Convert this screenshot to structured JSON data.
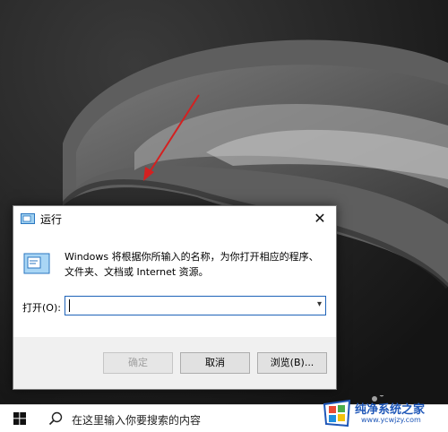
{
  "dialog": {
    "title": "运行",
    "close_label": "✕",
    "description": "Windows 将根据你所输入的名称，为你打开相应的程序、文件夹、文档或 Internet 资源。",
    "open_label": "打开(O):",
    "open_value": "",
    "buttons": {
      "ok": "确定",
      "cancel": "取消",
      "browse": "浏览(B)..."
    }
  },
  "taskbar": {
    "search_placeholder": "在这里输入你要搜索的内容"
  },
  "watermark": {
    "title": "纯净系统之家",
    "url": "www.ycwjzy.com"
  },
  "icons": {
    "start": "windows-logo-icon",
    "search": "search-icon",
    "run": "run-app-icon",
    "arrow": "red-arrow-annotation"
  },
  "colors": {
    "accent": "#1e63b8",
    "annotation_arrow": "#d42020",
    "watermark": "#1f57b8"
  }
}
